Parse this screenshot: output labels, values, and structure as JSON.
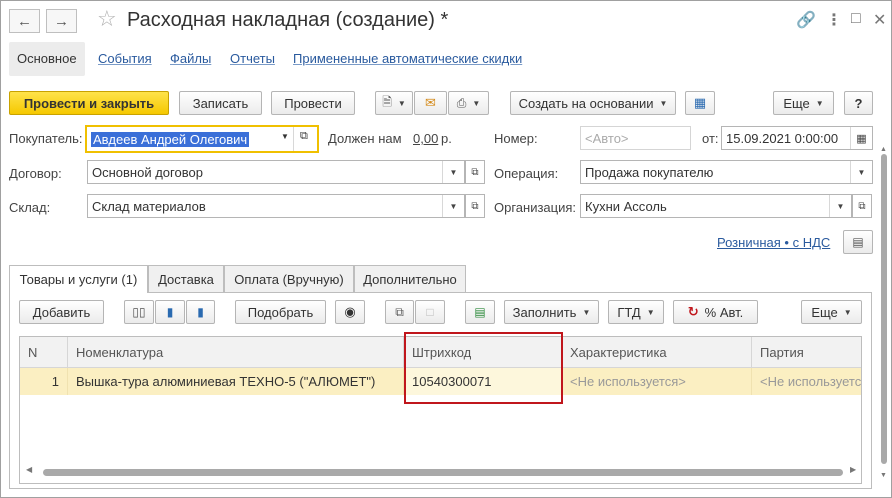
{
  "window": {
    "title": "Расходная накладная (создание) *",
    "back_icon": "arrow-left-icon",
    "forward_icon": "arrow-right-icon",
    "favorite_icon": "star-icon",
    "link_icon": "link-icon",
    "menu_icon": "more-vertical-icon",
    "maximize_icon": "maximize-icon",
    "close_icon": "close-icon"
  },
  "top_tabs": [
    {
      "label": "Основное",
      "active": true
    },
    {
      "label": "События"
    },
    {
      "label": "Файлы"
    },
    {
      "label": "Отчеты"
    },
    {
      "label": "Примененные автоматические скидки"
    }
  ],
  "toolbar": {
    "post_close": "Провести и закрыть",
    "save": "Записать",
    "post": "Провести",
    "create_based": "Создать на основании",
    "more": "Еще",
    "help": "?"
  },
  "form": {
    "buyer_label": "Покупатель:",
    "buyer_value": "Авдеев Андрей Олегович",
    "owes_label": "Должен нам",
    "owes_value": "0,00",
    "owes_unit": "р.",
    "number_label": "Номер:",
    "number_placeholder": "<Авто>",
    "date_label": "от:",
    "date_value": "15.09.2021  0:00:00",
    "contract_label": "Договор:",
    "contract_value": "Основной договор",
    "operation_label": "Операция:",
    "operation_value": "Продажа покупателю",
    "warehouse_label": "Склад:",
    "warehouse_value": "Склад материалов",
    "org_label": "Организация:",
    "org_value": "Кухни Ассоль",
    "price_type_link": "Розничная • с НДС"
  },
  "doc_tabs": [
    {
      "label": "Товары и услуги (1)",
      "active": true
    },
    {
      "label": "Доставка"
    },
    {
      "label": "Оплата (Вручную)"
    },
    {
      "label": "Дополнительно"
    }
  ],
  "table_toolbar": {
    "add": "Добавить",
    "pick": "Подобрать",
    "fill": "Заполнить",
    "gtd": "ГТД",
    "auto_discount": "% Авт.",
    "more": "Еще"
  },
  "table": {
    "columns": [
      "N",
      "Номенклатура",
      "Штрихкод",
      "Характеристика",
      "Партия"
    ],
    "rows": [
      {
        "n": "1",
        "item": "Вышка-тура алюминиевая ТЕХНО-5 (\"АЛЮМЕТ\")",
        "barcode": "10540300071",
        "characteristic": "<Не используется>",
        "batch": "<Не используетс"
      }
    ]
  },
  "colors": {
    "primary_button": "#f5c800",
    "link": "#2a5a9e",
    "selected_row": "#fbefc2",
    "highlight_box": "#c0161c",
    "focus_border": "#f0c000"
  }
}
